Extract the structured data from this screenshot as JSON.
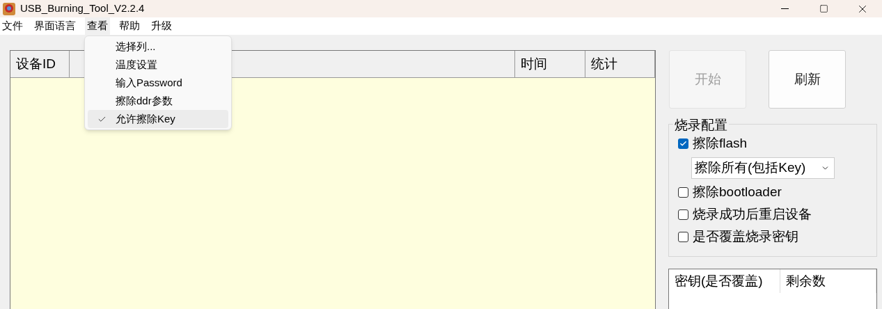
{
  "window": {
    "title": "USB_Burning_Tool_V2.2.4"
  },
  "menu_bar": [
    {
      "label": "文件",
      "selected": false
    },
    {
      "label": "界面语言",
      "selected": false
    },
    {
      "label": "查看",
      "selected": true
    },
    {
      "label": "帮助",
      "selected": false
    },
    {
      "label": "升级",
      "selected": false
    }
  ],
  "dropdown": [
    {
      "label": "选择列...",
      "checked": false,
      "selected": false
    },
    {
      "label": "温度设置",
      "checked": false,
      "selected": false
    },
    {
      "label": "输入Password",
      "checked": false,
      "selected": false
    },
    {
      "label": "擦除ddr参数",
      "checked": false,
      "selected": false
    },
    {
      "label": "允许擦除Key",
      "checked": true,
      "selected": true
    }
  ],
  "device_table": {
    "columns": [
      {
        "kind": "header",
        "label": "设备ID"
      },
      {
        "kind": "covered"
      },
      {
        "kind": "header",
        "label": "时间"
      },
      {
        "kind": "header",
        "label": "统计"
      }
    ]
  },
  "buttons": [
    {
      "label": "开始",
      "disabled": true
    },
    {
      "label": "刷新",
      "disabled": false
    }
  ],
  "burn_config": {
    "title": "烧录配置",
    "options": [
      {
        "kind": "checkbox",
        "label": "擦除flash",
        "checked": true
      },
      {
        "kind": "dropdown",
        "value": "擦除所有(包括Key)"
      },
      {
        "kind": "checkbox",
        "label": "擦除bootloader",
        "checked": false
      },
      {
        "kind": "checkbox",
        "label": "烧录成功后重启设备",
        "checked": false
      },
      {
        "kind": "checkbox",
        "label": "是否覆盖烧录密钥",
        "checked": false
      }
    ]
  },
  "key_table": {
    "columns": [
      "密钥(是否覆盖)",
      "剩余数"
    ]
  }
}
